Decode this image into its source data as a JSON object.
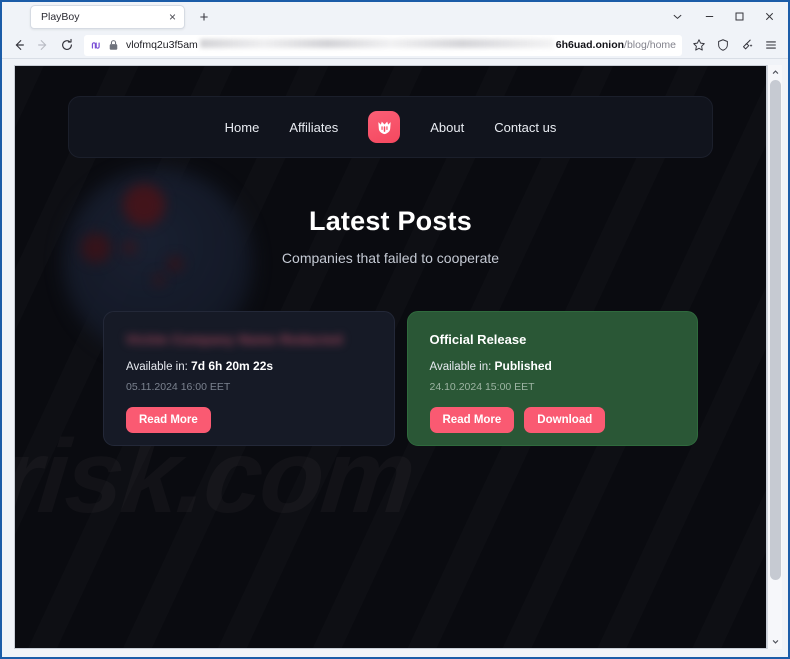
{
  "browser": {
    "tab": {
      "title": "PlayBoy",
      "close_label": "×"
    },
    "new_tab_label": "+",
    "window_controls": {
      "list_all_tabs": "⌄",
      "minimize": "–",
      "maximize": "☐",
      "close": "✕"
    },
    "toolbar": {
      "back": "←",
      "forward": "→",
      "reload": "↻",
      "bookmark": "☆",
      "shield": "shield",
      "extensions": "✦",
      "menu": "☰"
    },
    "urlbar": {
      "prefix": "vlofmq2u3f5am",
      "host": "6h6uad.onion",
      "path": "/blog/home"
    }
  },
  "site": {
    "nav": {
      "links_left": [
        {
          "label": "Home"
        },
        {
          "label": "Affiliates"
        }
      ],
      "links_right": [
        {
          "label": "About"
        },
        {
          "label": "Contact us"
        }
      ],
      "logo_name": "playboy-logo"
    },
    "hero": {
      "title": "Latest Posts",
      "subtitle": "Companies that failed to cooperate"
    },
    "watermark": "risk.com",
    "cards": [
      {
        "variant": "dark",
        "title": "Victim Company Name Redacted",
        "title_redacted": true,
        "available_label": "Available in:",
        "available_value": "7d 6h 20m 22s",
        "date": "05.11.2024 16:00 EET",
        "buttons": [
          {
            "label": "Read More"
          }
        ]
      },
      {
        "variant": "green",
        "title": "Official Release",
        "title_redacted": false,
        "available_label": "Available in:",
        "available_value": "Published",
        "date": "24.10.2024 15:00 EET",
        "buttons": [
          {
            "label": "Read More"
          },
          {
            "label": "Download"
          }
        ]
      }
    ]
  },
  "colors": {
    "accent_pink": "#fa5a72",
    "card_green": "#2a5736",
    "card_dark": "#161a26",
    "page_bg": "#0a0b10",
    "nav_bg": "#11141d"
  }
}
